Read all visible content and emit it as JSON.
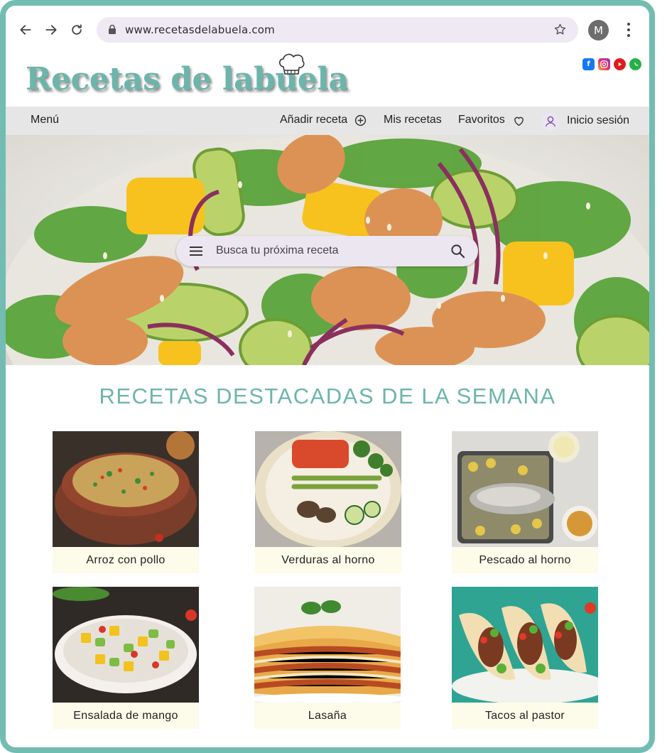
{
  "browser": {
    "url": "www.recetasdelabuela.com",
    "avatar_initial": "M"
  },
  "site": {
    "logo_text": "Recetas de labuela",
    "socials": [
      "facebook-icon",
      "instagram-icon",
      "youtube-icon",
      "whatsapp-icon"
    ]
  },
  "nav": {
    "menu": "Menú",
    "add_recipe": "Añadir receta",
    "my_recipes": "Mis recetas",
    "favorites": "Favoritos",
    "login": "Inicio sesión"
  },
  "search": {
    "placeholder": "Busca tu próxima receta"
  },
  "featured": {
    "title": "RECETAS DESTACADAS DE LA SEMANA",
    "recipes": [
      {
        "name": "Arroz con pollo"
      },
      {
        "name": "Verduras al horno"
      },
      {
        "name": "Pescado al horno"
      },
      {
        "name": "Ensalada de mango"
      },
      {
        "name": "Lasaña"
      },
      {
        "name": "Tacos al pastor"
      }
    ]
  },
  "colors": {
    "accent": "#6cb5aa",
    "frame": "#72bcb1",
    "caption_bg": "#fdfbe9",
    "navbar_bg": "#e6e6e6",
    "searchbar_bg": "#ece6f1"
  }
}
